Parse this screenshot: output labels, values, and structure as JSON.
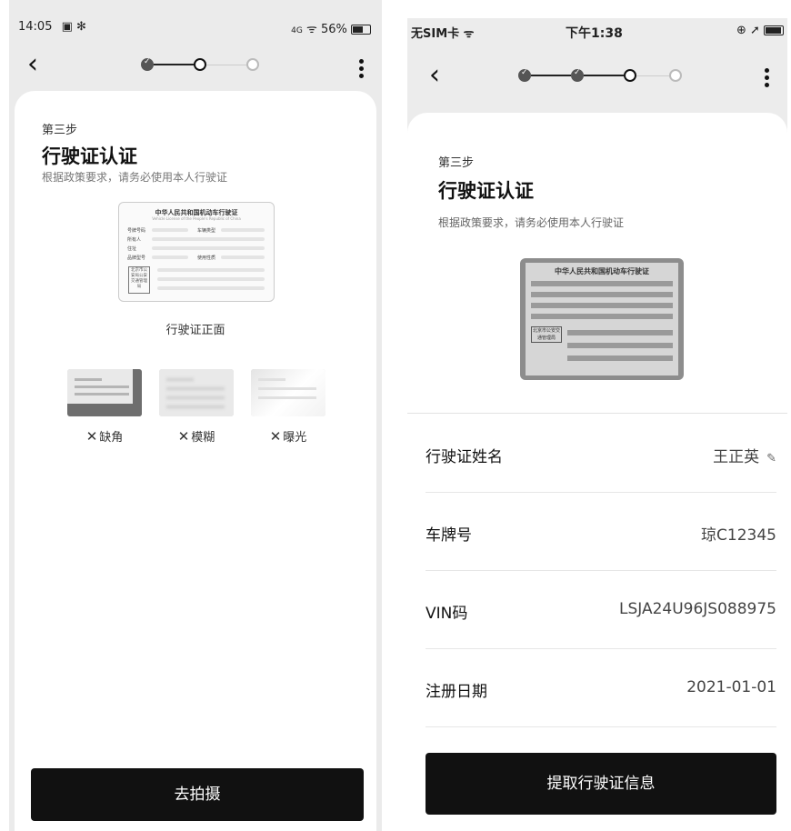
{
  "left": {
    "status": {
      "time": "14:05",
      "icons_left": "▣ ✻",
      "battery": "56%",
      "signal": "4G"
    },
    "step_label": "第三步",
    "title": "行驶证认证",
    "subtitle": "根据政策要求，请务必使用本人行驶证",
    "license": {
      "title": "中华人民共和国机动车行驶证",
      "subtitle_en": "Vehicle License of the People's Republic of China",
      "fields": [
        "号牌号码",
        "车辆类型",
        "所有人",
        "住址",
        "品牌型号",
        "使用性质"
      ],
      "seal": "北京市公安局公安交通管理局"
    },
    "caption": "行驶证正面",
    "bad_examples": [
      {
        "mark": "✕",
        "label": "缺角"
      },
      {
        "mark": "✕",
        "label": "模糊"
      },
      {
        "mark": "✕",
        "label": "曝光"
      }
    ],
    "button": "去拍摄"
  },
  "right": {
    "status": {
      "carrier": "无SIM卡",
      "wifi": "ᯤ",
      "time": "下午1:38",
      "icons": "⊕ ➚"
    },
    "step_label": "第三步",
    "title": "行驶证认证",
    "subtitle": "根据政策要求，请务必使用本人行驶证",
    "photo": {
      "title": "中华人民共和国机动车行驶证",
      "seal": "北京市公安交通管理局"
    },
    "rows": [
      {
        "key": "行驶证姓名",
        "value": "王正英",
        "editable": true
      },
      {
        "key": "车牌号",
        "value": "琼C12345"
      },
      {
        "key": "VIN码",
        "value": "LSJA24U96JS088975"
      },
      {
        "key": "注册日期",
        "value": "2021-01-01"
      }
    ],
    "button": "提取行驶证信息"
  },
  "icons": {
    "back": "chevron-left-icon",
    "more": "more-vertical-icon",
    "edit": "pencil-icon",
    "wifi": "wifi-icon",
    "battery": "battery-icon"
  },
  "colors": {
    "primary_button": "#111111",
    "background": "#ebebeb",
    "card": "#ffffff"
  }
}
